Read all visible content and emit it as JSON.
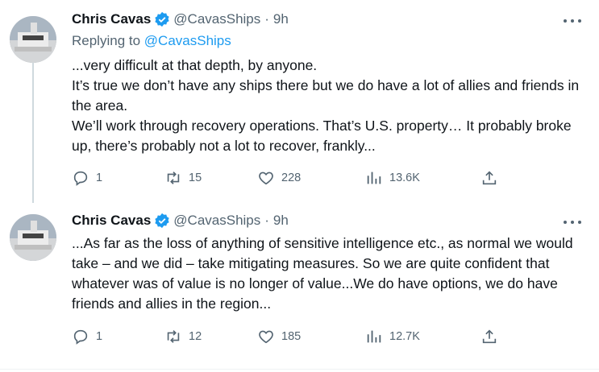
{
  "tweets": [
    {
      "author": "Chris Cavas",
      "handle": "@CavasShips",
      "separator": "·",
      "time": "9h",
      "replying_to_prefix": "Replying to ",
      "replying_to_handle": "@CavasShips",
      "lines": [
        "...very difficult at that depth, by anyone.",
        "It’s true we don’t have any ships there but we do have a lot of allies and friends in the area.",
        "We’ll work through recovery operations. That’s U.S. property… It probably broke up, there’s probably not a lot to recover, frankly..."
      ],
      "stats": {
        "replies": "1",
        "retweets": "15",
        "likes": "228",
        "views": "13.6K"
      }
    },
    {
      "author": "Chris Cavas",
      "handle": "@CavasShips",
      "separator": "·",
      "time": "9h",
      "lines": [
        "...As far as the loss of anything of sensitive intelligence etc., as normal we would take – and we did – take mitigating measures. So we are quite confident that whatever was of value is no longer of value...We do have options, we do have friends and allies in the region..."
      ],
      "stats": {
        "replies": "1",
        "retweets": "12",
        "likes": "185",
        "views": "12.7K"
      }
    }
  ],
  "colors": {
    "text": "#0f1419",
    "secondary": "#536471",
    "link": "#1d9bf0",
    "verified": "#1d9bf0"
  },
  "icons": [
    "verified-badge-icon",
    "more-icon",
    "reply-icon",
    "retweet-icon",
    "like-icon",
    "views-icon",
    "share-icon"
  ]
}
